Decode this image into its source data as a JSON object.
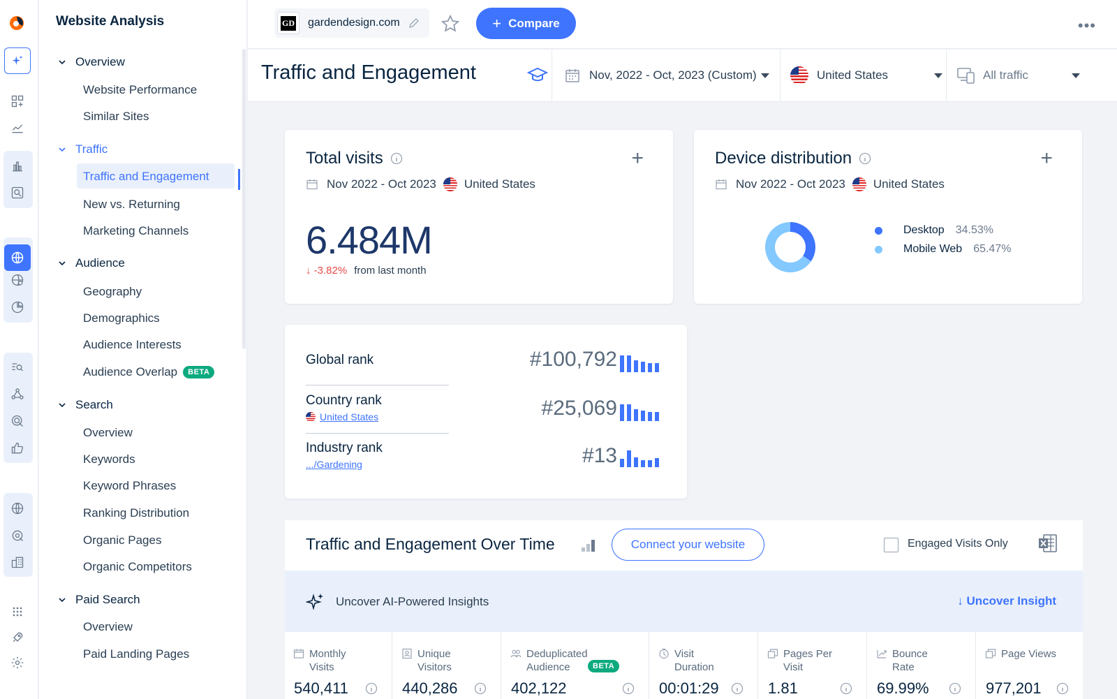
{
  "nav": {
    "title": "Website Analysis",
    "sections": [
      {
        "label": "Overview",
        "items": [
          "Website Performance",
          "Similar Sites"
        ]
      },
      {
        "label": "Traffic",
        "items": [
          "Traffic and Engagement",
          "New vs. Returning",
          "Marketing Channels"
        ]
      },
      {
        "label": "Audience",
        "items": [
          "Geography",
          "Demographics",
          "Audience Interests",
          "Audience Overlap"
        ]
      },
      {
        "label": "Search",
        "items": [
          "Overview",
          "Keywords",
          "Keyword Phrases",
          "Ranking Distribution",
          "Organic Pages",
          "Organic Competitors"
        ]
      },
      {
        "label": "Paid Search",
        "items": [
          "Overview",
          "Paid Landing Pages"
        ]
      }
    ],
    "beta_label": "BETA"
  },
  "topbar": {
    "favicon_text": "GD",
    "domain": "gardendesign.com",
    "compare_label": "Compare",
    "more": "•••"
  },
  "header": {
    "title": "Traffic and Engagement",
    "date_range": "Nov, 2022 - Oct, 2023 (Custom)",
    "country": "United States",
    "traffic_type": "All traffic"
  },
  "total_visits": {
    "title": "Total visits",
    "period": "Nov 2022 - Oct 2023",
    "country": "United States",
    "value": "6.484M",
    "change": "-3.82%",
    "change_note": "from last month"
  },
  "device": {
    "title": "Device distribution",
    "period": "Nov 2022 - Oct 2023",
    "country": "United States",
    "items": [
      {
        "label": "Desktop",
        "pct": "34.53%",
        "value": 34.53,
        "color": "#3e74fe"
      },
      {
        "label": "Mobile Web",
        "pct": "65.47%",
        "value": 65.47,
        "color": "#83c8ff"
      }
    ]
  },
  "ranks": {
    "global_label": "Global rank",
    "global_value": "#100,792",
    "country_label": "Country rank",
    "country_link": "United States",
    "country_value": "#25,069",
    "industry_label": "Industry rank",
    "industry_link": ".../Gardening",
    "industry_value": "#13"
  },
  "over_time": {
    "title": "Traffic and Engagement Over Time",
    "connect_label": "Connect your website",
    "engaged_label": "Engaged Visits Only",
    "insight_text": "Uncover AI-Powered Insights",
    "insight_link": "Uncover Insight",
    "metrics": [
      {
        "l1": "Monthly",
        "l2": "Visits",
        "value": "540,411"
      },
      {
        "l1": "Unique",
        "l2": "Visitors",
        "value": "440,286"
      },
      {
        "l1": "Deduplicated",
        "l2": "Audience",
        "value": "402,122"
      },
      {
        "l1": "Visit",
        "l2": "Duration",
        "value": "00:01:29"
      },
      {
        "l1": "Pages Per",
        "l2": "Visit",
        "value": "1.81"
      },
      {
        "l1": "Bounce",
        "l2": "Rate",
        "value": "69.99%"
      },
      {
        "l1": "Page Views",
        "l2": "",
        "value": "977,201"
      }
    ]
  }
}
